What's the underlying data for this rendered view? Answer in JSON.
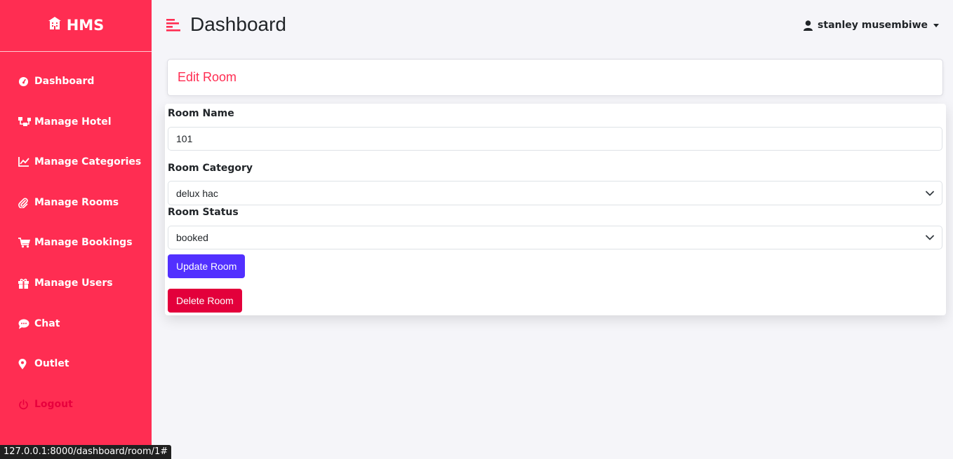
{
  "brand": {
    "name": "HMS",
    "icon": "hotel-icon"
  },
  "sidebar": {
    "items": [
      {
        "label": "Dashboard",
        "icon": "gauge-icon"
      },
      {
        "label": "Manage Hotel",
        "icon": "sitemap-icon"
      },
      {
        "label": "Manage Categories",
        "icon": "chart-line-icon"
      },
      {
        "label": "Manage Rooms",
        "icon": "paperclip-icon"
      },
      {
        "label": "Manage Bookings",
        "icon": "cart-icon"
      },
      {
        "label": "Manage Users",
        "icon": "gift-icon"
      },
      {
        "label": "Chat",
        "icon": "chat-icon"
      },
      {
        "label": "Outlet",
        "icon": "map-pin-icon"
      },
      {
        "label": "Logout",
        "icon": "power-icon"
      }
    ]
  },
  "header": {
    "title": "Dashboard",
    "user_name": "stanley musembiwe"
  },
  "card": {
    "title": "Edit Room"
  },
  "form": {
    "room_name_label": "Room Name",
    "room_name_value": "101",
    "room_category_label": "Room Category",
    "room_category_value": "delux hac",
    "room_status_label": "Room Status",
    "room_status_value": "booked",
    "update_button": "Update Room",
    "delete_button": "Delete Room"
  },
  "status_bar": {
    "url": "127.0.0.1:8000/dashboard/room/1#"
  },
  "colors": {
    "sidebar": "#ff2d52",
    "accent": "#ff2d52",
    "primary_button": "#5230ff",
    "danger_button": "#e3003b",
    "logout_text": "#e8003d"
  }
}
